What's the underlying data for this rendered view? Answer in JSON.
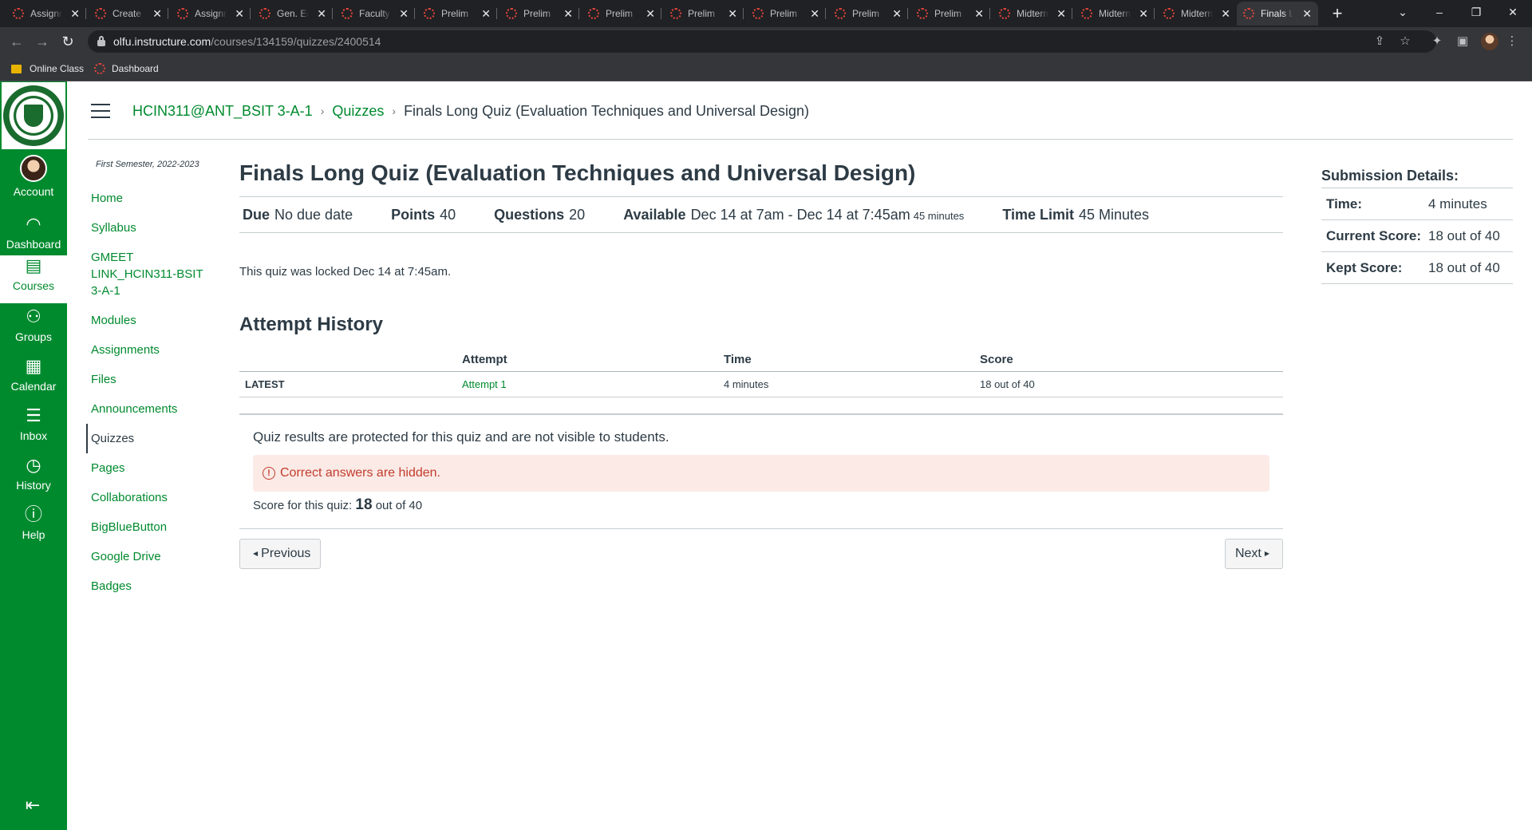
{
  "browser": {
    "tabs": [
      {
        "title": "Assignment"
      },
      {
        "title": "Create"
      },
      {
        "title": "Assignment"
      },
      {
        "title": "Gen. Ed."
      },
      {
        "title": "Faculty"
      },
      {
        "title": "Prelim"
      },
      {
        "title": "Prelim"
      },
      {
        "title": "Prelim"
      },
      {
        "title": "Prelim"
      },
      {
        "title": "Prelim"
      },
      {
        "title": "Prelim"
      },
      {
        "title": "Prelim"
      },
      {
        "title": "Midterm"
      },
      {
        "title": "Midterm"
      },
      {
        "title": "Midterm"
      },
      {
        "title": "Finals L"
      }
    ],
    "url_host": "olfu.instructure.com",
    "url_path": "/courses/134159/quizzes/2400514",
    "bookmarks": [
      "Online Class",
      "Dashboard"
    ]
  },
  "global_nav": {
    "account": "Account",
    "dashboard": "Dashboard",
    "courses": "Courses",
    "groups": "Groups",
    "calendar": "Calendar",
    "inbox": "Inbox",
    "history": "History",
    "help": "Help"
  },
  "breadcrumb": {
    "course": "HCIN311@ANT_BSIT 3-A-1",
    "section": "Quizzes",
    "current": "Finals Long Quiz (Evaluation Techniques and Universal Design)"
  },
  "course_nav": {
    "term": "First Semester, 2022-2023",
    "items": [
      "Home",
      "Syllabus",
      "GMEET LINK_HCIN311-BSIT 3-A-1",
      "Modules",
      "Assignments",
      "Files",
      "Announcements",
      "Quizzes",
      "Pages",
      "Collaborations",
      "BigBlueButton",
      "Google Drive",
      "Badges"
    ]
  },
  "quiz": {
    "title": "Finals Long Quiz (Evaluation Techniques and Universal Design)",
    "due_label": "Due",
    "due": "No due date",
    "points_label": "Points",
    "points": "40",
    "questions_label": "Questions",
    "questions": "20",
    "available_label": "Available",
    "available": "Dec 14 at 7am - Dec 14 at 7:45am",
    "available_duration": "45 minutes",
    "time_limit_label": "Time Limit",
    "time_limit": "45 Minutes",
    "locked_message": "This quiz was locked Dec 14 at 7:45am.",
    "attempt_history_title": "Attempt History",
    "table": {
      "headers": [
        "",
        "Attempt",
        "Time",
        "Score"
      ],
      "row": {
        "label": "LATEST",
        "attempt": "Attempt 1",
        "time": "4 minutes",
        "score": "18 out of 40"
      }
    },
    "protected_message": "Quiz results are protected for this quiz and are not visible to students.",
    "alert": "Correct answers are hidden.",
    "score_prefix": "Score for this quiz:",
    "score": "18",
    "score_suffix": "out of 40",
    "prev_label": "Previous",
    "next_label": "Next"
  },
  "submission": {
    "title": "Submission Details:",
    "time_label": "Time:",
    "time": "4 minutes",
    "current_label": "Current Score:",
    "current": "18 out of 40",
    "kept_label": "Kept Score:",
    "kept": "18 out of 40"
  },
  "colors": {
    "brand": "#008a2e",
    "text": "#2d3b45",
    "alert_bg": "#fbeae6",
    "alert_text": "#c23c2d"
  }
}
